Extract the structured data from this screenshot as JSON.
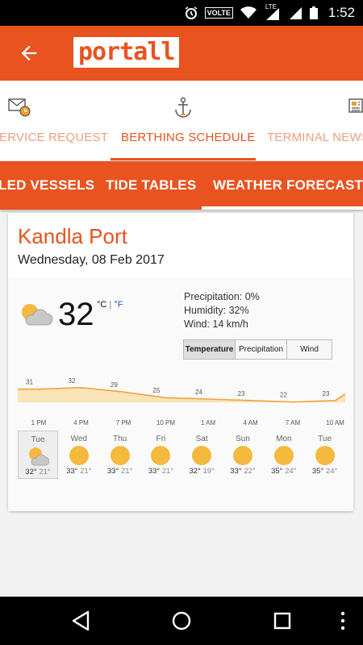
{
  "status_bar": {
    "network": "VOLTE",
    "lte": "LTE",
    "time": "1:52"
  },
  "app_bar": {
    "logo_text": "portall",
    "brand_color": "#e8531f"
  },
  "icon_tabs": [
    {
      "label": "ERVICE REQUEST",
      "icon": "mail-clock-icon",
      "active": false
    },
    {
      "label": "BERTHING SCHEDULE",
      "icon": "anchor-icon",
      "active": true
    },
    {
      "label": "TERMINAL NEWS",
      "icon": "news-icon",
      "active": false
    }
  ],
  "sub_tabs": [
    {
      "label": "LED VESSELS",
      "active": false
    },
    {
      "label": "TIDE TABLES",
      "active": false
    },
    {
      "label": "WEATHER FORECAST",
      "active": true
    }
  ],
  "forecast": {
    "place": "Kandla Port",
    "date": "Wednesday, 08 Feb 2017",
    "current_temp": "32",
    "unit_c": "°C",
    "unit_sep": "|",
    "unit_f": "°F",
    "current_icon": "partly-cloudy-icon",
    "precipitation": "Precipitation: 0%",
    "humidity": "Humidity: 32%",
    "wind": "Wind: 14 km/h",
    "toggle_buttons": [
      "Temperature",
      "Precipitation",
      "Wind"
    ],
    "selected_toggle": "Temperature"
  },
  "chart_data": {
    "type": "area",
    "x": [
      "1 PM",
      "4 PM",
      "7 PM",
      "10 PM",
      "1 AM",
      "4 AM",
      "7 AM",
      "10 AM"
    ],
    "values": [
      31,
      32,
      29,
      25,
      24,
      23,
      22,
      23
    ],
    "point_labels": [
      "31",
      "32",
      "29",
      "25",
      "24",
      "23",
      "22",
      "23"
    ],
    "line_color": "#f0a030",
    "fill_color": "#fbe3b8"
  },
  "daily": [
    {
      "day": "Tue",
      "hi": "32°",
      "lo": "21°",
      "icon": "partly-cloudy-icon",
      "selected": true
    },
    {
      "day": "Wed",
      "hi": "33°",
      "lo": "21°",
      "icon": "sun-icon",
      "selected": false
    },
    {
      "day": "Thu",
      "hi": "33°",
      "lo": "21°",
      "icon": "sun-icon",
      "selected": false
    },
    {
      "day": "Fri",
      "hi": "33°",
      "lo": "21°",
      "icon": "sun-icon",
      "selected": false
    },
    {
      "day": "Sat",
      "hi": "32°",
      "lo": "19°",
      "icon": "sun-icon",
      "selected": false
    },
    {
      "day": "Sun",
      "hi": "33°",
      "lo": "22°",
      "icon": "sun-icon",
      "selected": false
    },
    {
      "day": "Mon",
      "hi": "35°",
      "lo": "24°",
      "icon": "sun-icon",
      "selected": false
    },
    {
      "day": "Tue",
      "hi": "35°",
      "lo": "24°",
      "icon": "sun-icon",
      "selected": false
    }
  ]
}
